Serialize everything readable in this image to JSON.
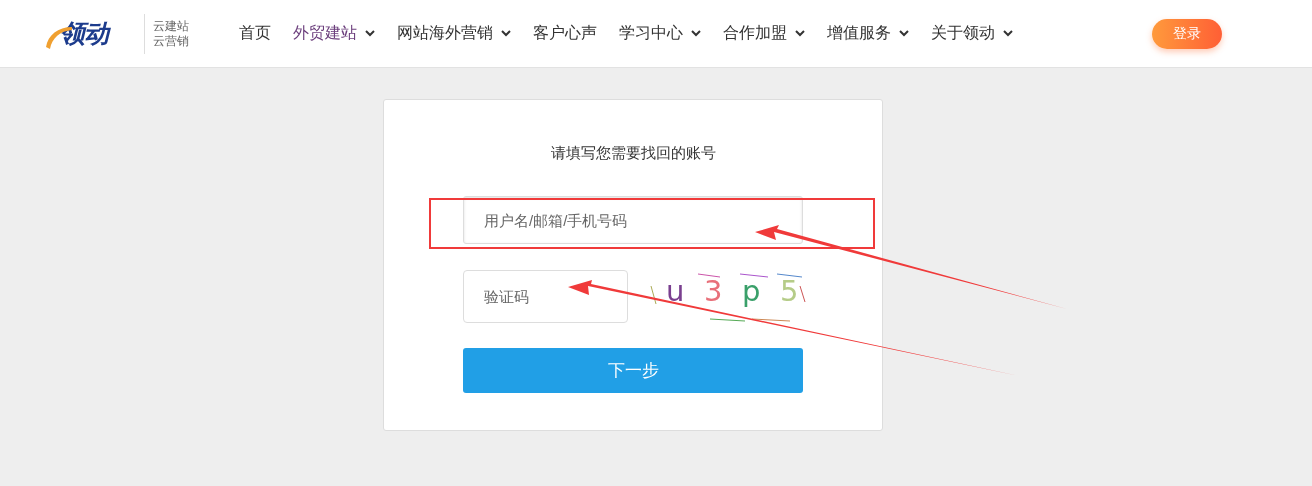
{
  "header": {
    "logo": {
      "mark": "领动",
      "tagline": [
        "云建站",
        "云营销"
      ]
    },
    "nav": [
      {
        "label": "首页",
        "caret": false,
        "selected": false
      },
      {
        "label": "外贸建站",
        "caret": true,
        "selected": true
      },
      {
        "label": "网站海外营销",
        "caret": true,
        "selected": false
      },
      {
        "label": "客户心声",
        "caret": false,
        "selected": false
      },
      {
        "label": "学习中心",
        "caret": true,
        "selected": false
      },
      {
        "label": "合作加盟",
        "caret": true,
        "selected": false
      },
      {
        "label": "增值服务",
        "caret": true,
        "selected": false
      },
      {
        "label": "关于领动",
        "caret": true,
        "selected": false
      }
    ],
    "login_button": "登录"
  },
  "form": {
    "title": "请填写您需要找回的账号",
    "account_field": {
      "placeholder": "用户名/邮箱/手机号码"
    },
    "captcha_field": {
      "placeholder": "验证码"
    },
    "captcha": [
      {
        "char": "u",
        "color": "#7a3f8f"
      },
      {
        "char": "3",
        "color": "#e8707a"
      },
      {
        "char": "p",
        "color": "#3aa06a"
      },
      {
        "char": "5",
        "color": "#b5cc88"
      }
    ],
    "next_button": "下一步"
  }
}
